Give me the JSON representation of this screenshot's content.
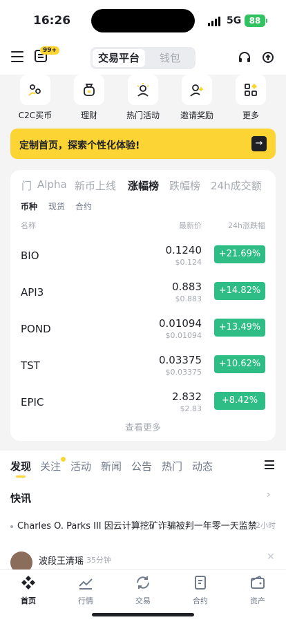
{
  "status_bar": {
    "time": "16:26",
    "network": "5G",
    "battery": "88"
  },
  "header": {
    "message_badge": "99+",
    "segment_active": "交易平台",
    "segment_inactive": "钱包"
  },
  "quick_actions": [
    {
      "label": "C2C买币",
      "icon": "c2c-icon"
    },
    {
      "label": "理财",
      "icon": "moneybag-icon"
    },
    {
      "label": "热门活动",
      "icon": "event-icon"
    },
    {
      "label": "邀请奖励",
      "icon": "invite-icon"
    },
    {
      "label": "更多",
      "icon": "grid-icon"
    }
  ],
  "banner": {
    "text": "定制首页，探索个性化体验!",
    "arrow": "→"
  },
  "market": {
    "tabs": [
      "门",
      "Alpha",
      "新币上线",
      "涨幅榜",
      "跌幅榜",
      "24h成交额"
    ],
    "active_tab": "涨幅榜",
    "sub_tabs": [
      "币种",
      "现货",
      "合约"
    ],
    "columns": {
      "name": "名称",
      "price": "最新价",
      "change": "24h涨跌幅"
    },
    "rows": [
      {
        "symbol": "BIO",
        "price": "0.1240",
        "usd": "$0.124",
        "change": "+21.69%"
      },
      {
        "symbol": "API3",
        "price": "0.883",
        "usd": "$0.883",
        "change": "+14.82%"
      },
      {
        "symbol": "POND",
        "price": "0.01094",
        "usd": "$0.01094",
        "change": "+13.49%"
      },
      {
        "symbol": "TST",
        "price": "0.03375",
        "usd": "$0.03375",
        "change": "+10.62%"
      },
      {
        "symbol": "EPIC",
        "price": "2.832",
        "usd": "$2.83",
        "change": "+8.42%"
      }
    ],
    "view_more": "查看更多"
  },
  "news_tabs": [
    "发现",
    "关注",
    "活动",
    "新闻",
    "公告",
    "热门",
    "动态"
  ],
  "news": {
    "section_title": "快讯",
    "headline": "Charles O. Parks III 因云计算挖矿诈骗被判一年零一天监禁",
    "headline_time": "2小时",
    "post_user": "波段王清瑶",
    "post_time": "35分钟"
  },
  "bottom_nav": [
    {
      "label": "首页",
      "icon": "home-icon"
    },
    {
      "label": "行情",
      "icon": "chart-icon"
    },
    {
      "label": "交易",
      "icon": "trade-icon"
    },
    {
      "label": "合约",
      "icon": "futures-icon"
    },
    {
      "label": "资产",
      "icon": "wallet-icon"
    }
  ],
  "colors": {
    "accent": "#fcd535",
    "positive": "#2ebd85",
    "text": "#1e2026",
    "muted": "#a5a9b0"
  }
}
